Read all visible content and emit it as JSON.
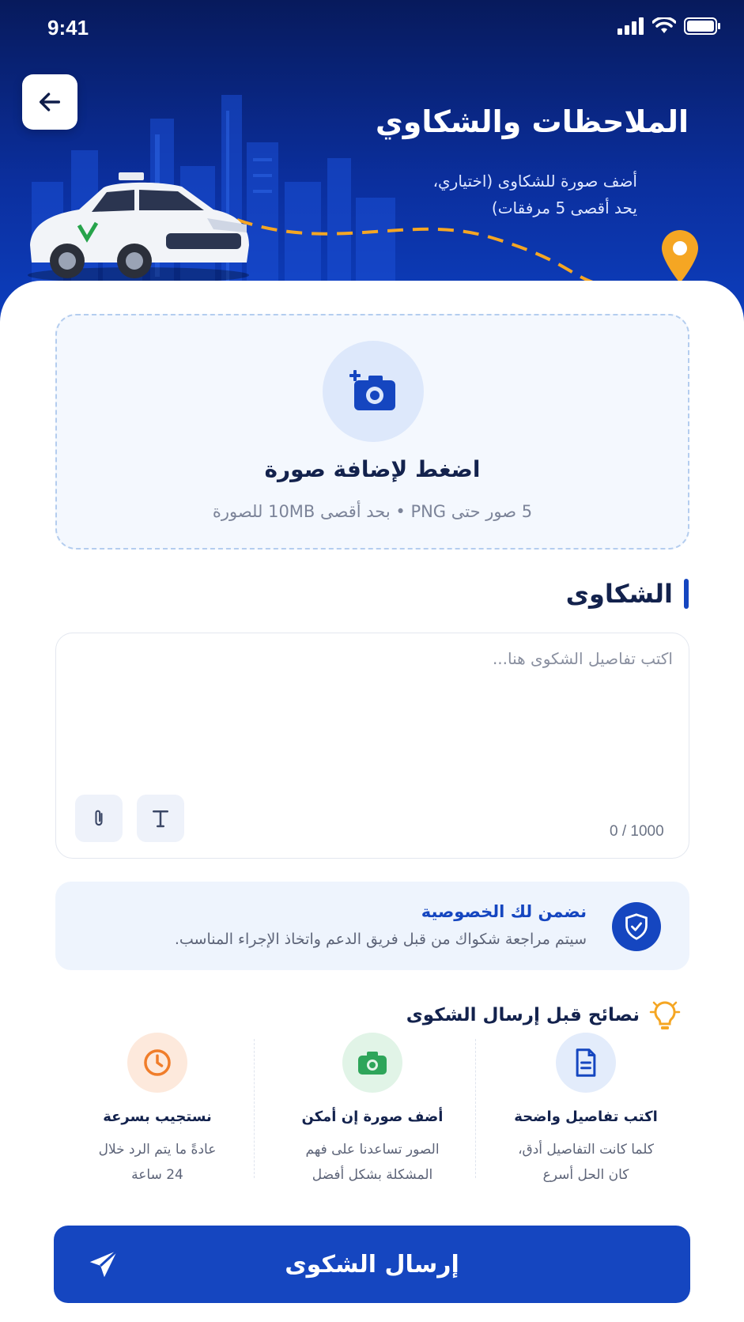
{
  "status_bar": {
    "time": "9:41"
  },
  "header": {
    "title": "الملاحظات والشكاوي",
    "subtitle_line1": "أضف صورة للشكاوى (اختياري،",
    "subtitle_line2": "يحد أقصى 5 مرفقات)",
    "back_icon": "arrow-left-icon"
  },
  "upload": {
    "icon": "add-camera-icon",
    "title": "اضغط لإضافة صورة",
    "hint": "5 صور حتى PNG • بحد أقصى 10MB للصورة"
  },
  "complaints": {
    "section_title": "الشكاوى",
    "placeholder": "اكتب تفاصيل الشكوى هنا...",
    "counter": "0 / 1000",
    "tools": [
      "text-format-icon",
      "attachment-icon"
    ]
  },
  "privacy": {
    "icon": "shield-check-icon",
    "title": "نضمن لك الخصوصية",
    "text": "سيتم مراجعة شكواك من قبل فريق الدعم واتخاذ الإجراء المناسب."
  },
  "tips": {
    "header": "نصائح قبل إرسال الشكوى",
    "icon": "lightbulb-icon",
    "items": [
      {
        "icon": "document-icon",
        "title": "اكتب تفاصيل واضحة",
        "line1": "كلما كانت التفاصيل أدق،",
        "line2": "كان الحل أسرع",
        "color": "#1546c0",
        "bg": "#e3ecfb"
      },
      {
        "icon": "camera-icon",
        "title": "أضف صورة إن أمكن",
        "line1": "الصور تساعدنا على فهم",
        "line2": "المشكلة بشكل أفضل",
        "color": "#2ea55a",
        "bg": "#e1f4e7"
      },
      {
        "icon": "clock-icon",
        "title": "نستجيب بسرعة",
        "line1": "عادةً ما يتم الرد خلال",
        "line2": "24 ساعة",
        "color": "#f07d2a",
        "bg": "#fde9dc"
      }
    ]
  },
  "submit": {
    "label": "إرسال الشكوى",
    "icon": "send-icon"
  },
  "colors": {
    "primary": "#1546c0",
    "hero_dark": "#071a5c",
    "route_dash": "#f5a623",
    "pin": "#f5a623"
  }
}
